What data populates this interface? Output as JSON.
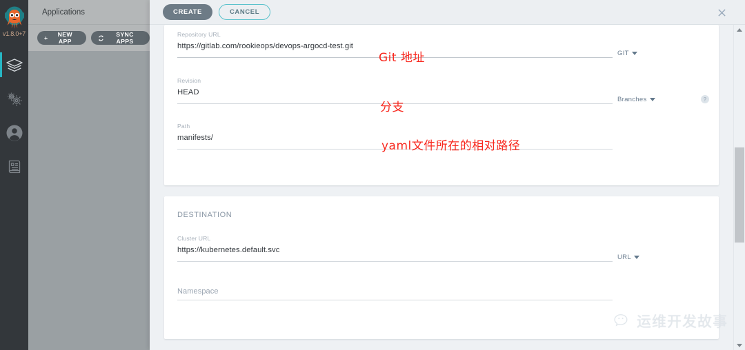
{
  "brand": {
    "logo_icon": "argo-octopus-icon",
    "version": "v1.8.0+7"
  },
  "nav_rail": {
    "items": [
      {
        "name": "applications",
        "icon": "layers-icon",
        "active": true
      },
      {
        "name": "settings",
        "icon": "gears-icon",
        "active": false
      },
      {
        "name": "user-info",
        "icon": "user-circle-icon",
        "active": false
      },
      {
        "name": "documentation",
        "icon": "book-icon",
        "active": false
      }
    ]
  },
  "backdrop": {
    "title": "Applications",
    "new_app_label": "NEW APP",
    "sync_apps_label": "SYNC APPS",
    "plus_icon": "plus-icon",
    "sync_icon": "refresh-icon"
  },
  "toolbar": {
    "create_label": "CREATE",
    "cancel_label": "CANCEL",
    "close_icon": "close-icon"
  },
  "source": {
    "repo_url": {
      "label": "Repository URL",
      "value": "https://gitlab.com/rookieops/devops-argocd-test.git"
    },
    "repo_type": {
      "value": "GIT",
      "caret_icon": "chevron-down-icon"
    },
    "revision": {
      "label": "Revision",
      "value": "HEAD"
    },
    "revision_type": {
      "value": "Branches",
      "caret_icon": "chevron-down-icon",
      "help_icon": "question-mark-icon",
      "help_label": "?"
    },
    "path": {
      "label": "Path",
      "value": "manifests/"
    }
  },
  "destination": {
    "section_title": "DESTINATION",
    "cluster_url": {
      "label": "Cluster URL",
      "value": "https://kubernetes.default.svc"
    },
    "cluster_type": {
      "value": "URL",
      "caret_icon": "chevron-down-icon"
    },
    "namespace": {
      "label": "Namespace",
      "value": "",
      "placeholder": "Namespace"
    }
  },
  "annotations": [
    {
      "text": "Git 地址",
      "target": "repository-url"
    },
    {
      "text": "分支",
      "target": "revision"
    },
    {
      "text": "yaml文件所在的相对路径",
      "target": "path"
    }
  ],
  "scrollbar": {
    "up_icon": "triangle-up-icon",
    "down_icon": "triangle-down-icon"
  },
  "watermark": {
    "text": "运维开发故事",
    "icon": "wechat-icon"
  },
  "colors": {
    "accent_teal": "#27b6c4",
    "annotation_red": "#f8281e",
    "nav_dark": "#33373b",
    "panel_bg": "#eef1f4"
  }
}
